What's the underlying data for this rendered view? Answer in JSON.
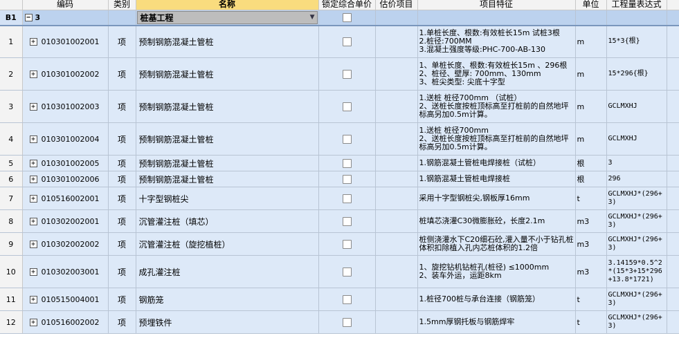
{
  "headers": [
    "",
    "编码",
    "类别",
    "名称",
    "锁定综合单价",
    "估价项目",
    "项目特征",
    "单位",
    "工程量表达式"
  ],
  "group": {
    "row_label": "B1",
    "code": "3",
    "name": "桩基工程",
    "expand_icon": "minus",
    "dropdown_icon": "triangle-down"
  },
  "rows": [
    {
      "n": "1",
      "code": "010301002001",
      "type": "项",
      "name": "预制钢筋混凝土管桩",
      "feature": "1.单桩长度、根数:有效桩长15m  试桩3根\n2.桩径:700MM\n3.混凝土强度等级:PHC-700-AB-130",
      "unit": "m",
      "expr": "15*3{根}"
    },
    {
      "n": "2",
      "code": "010301002002",
      "type": "项",
      "name": "预制钢筋混凝土管桩",
      "feature": "1、单桩长度、根数:有效桩长15m 、296根\n2、桩径、壁厚: 700mm、130mm\n3、桩尖类型: 尖底十字型",
      "unit": "m",
      "expr": "15*296{根}"
    },
    {
      "n": "3",
      "code": "010301002003",
      "type": "项",
      "name": "预制钢筋混凝土管桩",
      "feature": "1.送桩 桩径700mm （试桩）\n2、送桩长度按桩顶标高至打桩前的自然地坪标高另加0.5m计算。",
      "unit": "m",
      "expr": "GCLMXHJ"
    },
    {
      "n": "4",
      "code": "010301002004",
      "type": "项",
      "name": "预制钢筋混凝土管桩",
      "feature": "1.送桩 桩径700mm\n2、送桩长度按桩顶标高至打桩前的自然地坪标高另加0.5m计算。",
      "unit": "m",
      "expr": "GCLMXHJ"
    },
    {
      "n": "5",
      "code": "010301002005",
      "type": "项",
      "name": "预制钢筋混凝土管桩",
      "feature": "1.钢筋混凝土管桩电焊接桩（试桩）",
      "unit": "根",
      "expr": "3"
    },
    {
      "n": "6",
      "code": "010301002006",
      "type": "项",
      "name": "预制钢筋混凝土管桩",
      "feature": "1.钢筋混凝土管桩电焊接桩",
      "unit": "根",
      "expr": "296"
    },
    {
      "n": "7",
      "code": "010516002001",
      "type": "项",
      "name": "十字型钢桩尖",
      "feature": "采用十字型钢桩尖,钢板厚16mm",
      "unit": "t",
      "expr": "GCLMXHJ*(296+\n3)"
    },
    {
      "n": "8",
      "code": "010302002001",
      "type": "项",
      "name": "沉管灌注桩（填芯）",
      "feature": "桩填芯浇灌C30微膨胀砼，长度2.1m",
      "unit": "m3",
      "expr": "GCLMXHJ*(296+\n3)"
    },
    {
      "n": "9",
      "code": "010302002002",
      "type": "项",
      "name": "沉管灌注桩（旋挖植桩）",
      "feature": "桩侧浇灌水下C20细石砼,灌入量不小于钻孔桩体积扣除植入孔内芯桩体积的1.2倍",
      "unit": "m3",
      "expr": "GCLMXHJ*(296+\n3)"
    },
    {
      "n": "10",
      "code": "010302003001",
      "type": "项",
      "name": "成孔灌注桩",
      "feature": "1、旋挖钻机钻桩孔(桩径) ≤1000mm\n2、装车外运，运距8km",
      "unit": "m3",
      "expr": "3.14159*0.5^2\n*(15*3+15*296\n+13.8*1721)"
    },
    {
      "n": "11",
      "code": "010515004001",
      "type": "项",
      "name": "钢筋笼",
      "feature": "1.桩径700桩与承台连接（钢筋笼）",
      "unit": "t",
      "expr": "GCLMXHJ*(296+\n3)"
    },
    {
      "n": "12",
      "code": "010516002002",
      "type": "项",
      "name": "预埋铁件",
      "feature": "1.5mm厚钢托板与钢筋焊牢",
      "unit": "t",
      "expr": "GCLMXHJ*(296+\n3)"
    }
  ],
  "row_heights": [
    47,
    47,
    47,
    47,
    23,
    23,
    33,
    33,
    33,
    47,
    33,
    33
  ]
}
